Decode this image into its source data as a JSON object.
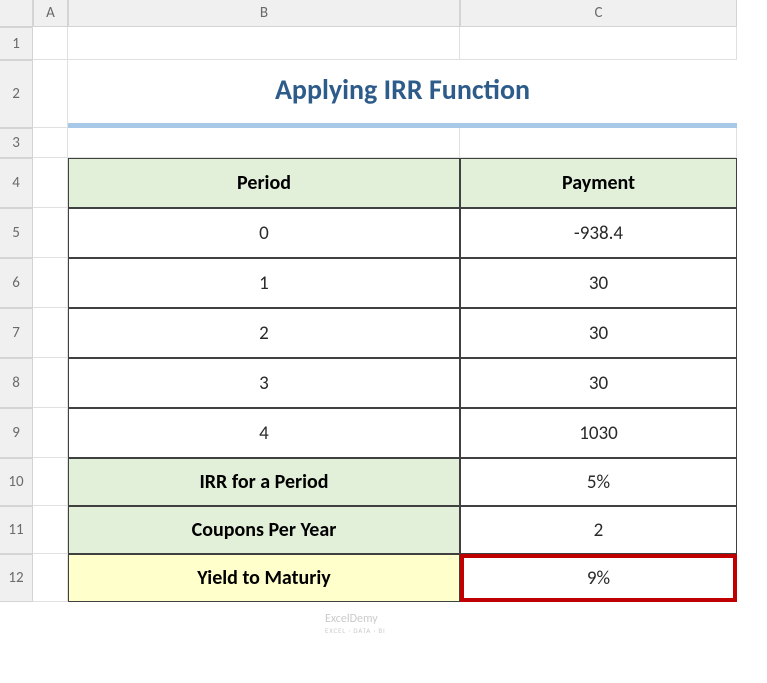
{
  "columns": [
    "A",
    "B",
    "C"
  ],
  "rows": [
    "1",
    "2",
    "3",
    "4",
    "5",
    "6",
    "7",
    "8",
    "9",
    "10",
    "11",
    "12"
  ],
  "title": "Applying IRR Function",
  "table": {
    "headers": {
      "period": "Period",
      "payment": "Payment"
    },
    "data": [
      {
        "period": "0",
        "payment": "-938.4"
      },
      {
        "period": "1",
        "payment": "30"
      },
      {
        "period": "2",
        "payment": "30"
      },
      {
        "period": "3",
        "payment": "30"
      },
      {
        "period": "4",
        "payment": "1030"
      }
    ]
  },
  "summary": {
    "irr_label": "IRR for a Period",
    "irr_value": "5%",
    "coupons_label": "Coupons Per Year",
    "coupons_value": "2",
    "ytm_label": "Yield to Maturiy",
    "ytm_value": "9%"
  },
  "watermark": {
    "main": "ExcelDemy",
    "sub": "EXCEL · DATA · BI"
  }
}
